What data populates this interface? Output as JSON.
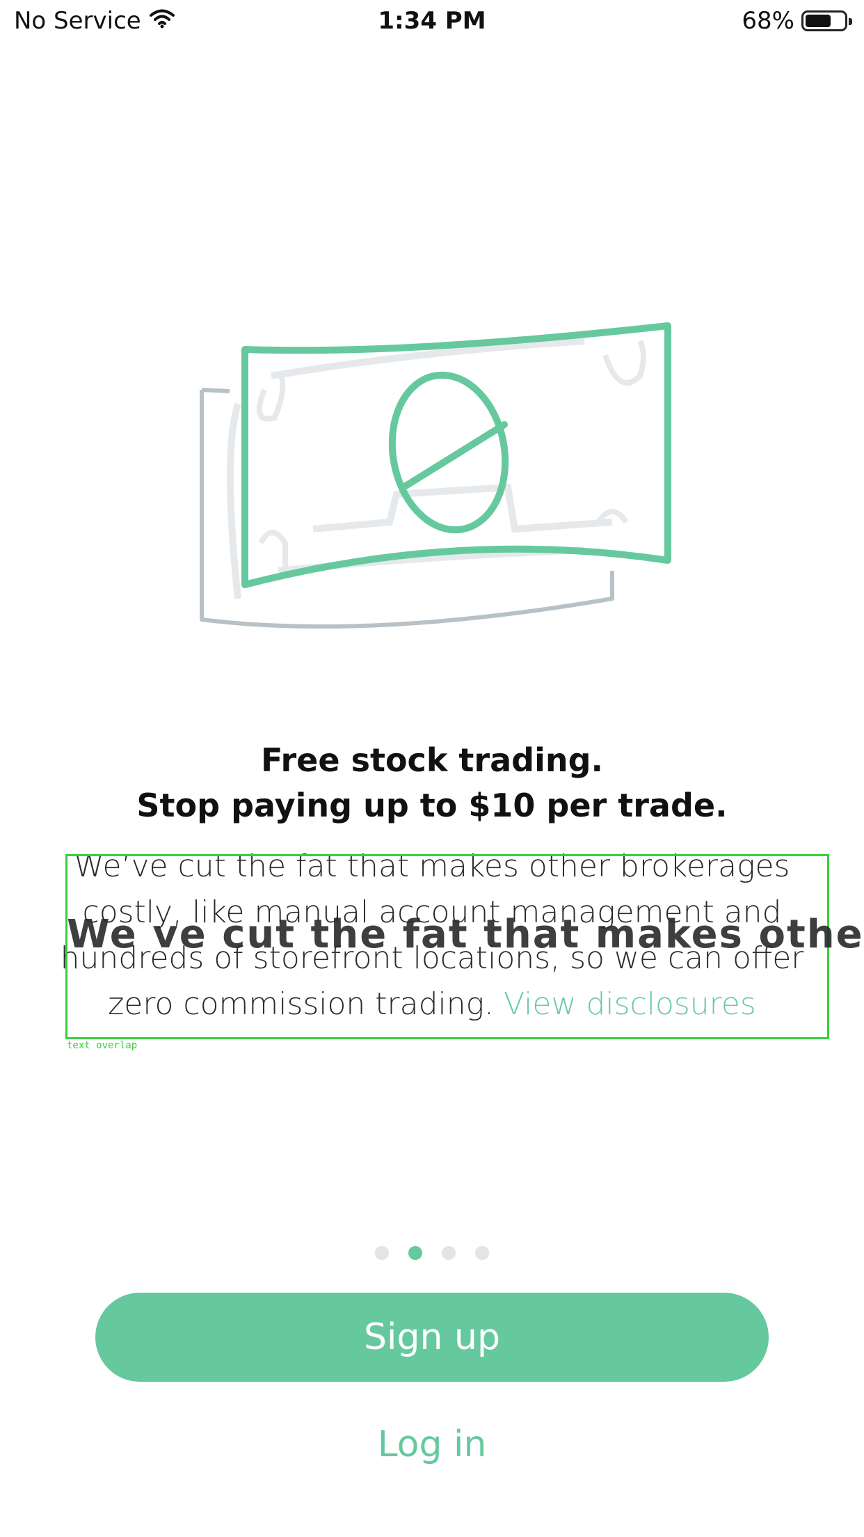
{
  "status_bar": {
    "carrier": "No Service",
    "time": "1:34 PM",
    "battery": "68%",
    "battery_level": 0.68,
    "wifi_icon": "wifi-icon",
    "battery_icon": "battery-icon"
  },
  "illustration": {
    "icon": "dollar-bill-illustration"
  },
  "headline": {
    "line1": "Free stock trading.",
    "line2": "Stop paying up to $10 per trade."
  },
  "body": {
    "text": "We’ve cut the fat that makes other brokerages costly, like manual account management and hundreds of storefront locations, so we can offer zero commission trading.",
    "link": "View disclosures"
  },
  "overlay": {
    "text": "We ve cut the fat that makes other b",
    "label": "text overlap"
  },
  "pager": {
    "count": 4,
    "active_index": 1
  },
  "buttons": {
    "signup": "Sign up",
    "login": "Log in"
  },
  "colors": {
    "accent": "#66c99e",
    "link": "#6cc9a3",
    "dot_inactive": "#e4e4e4"
  }
}
